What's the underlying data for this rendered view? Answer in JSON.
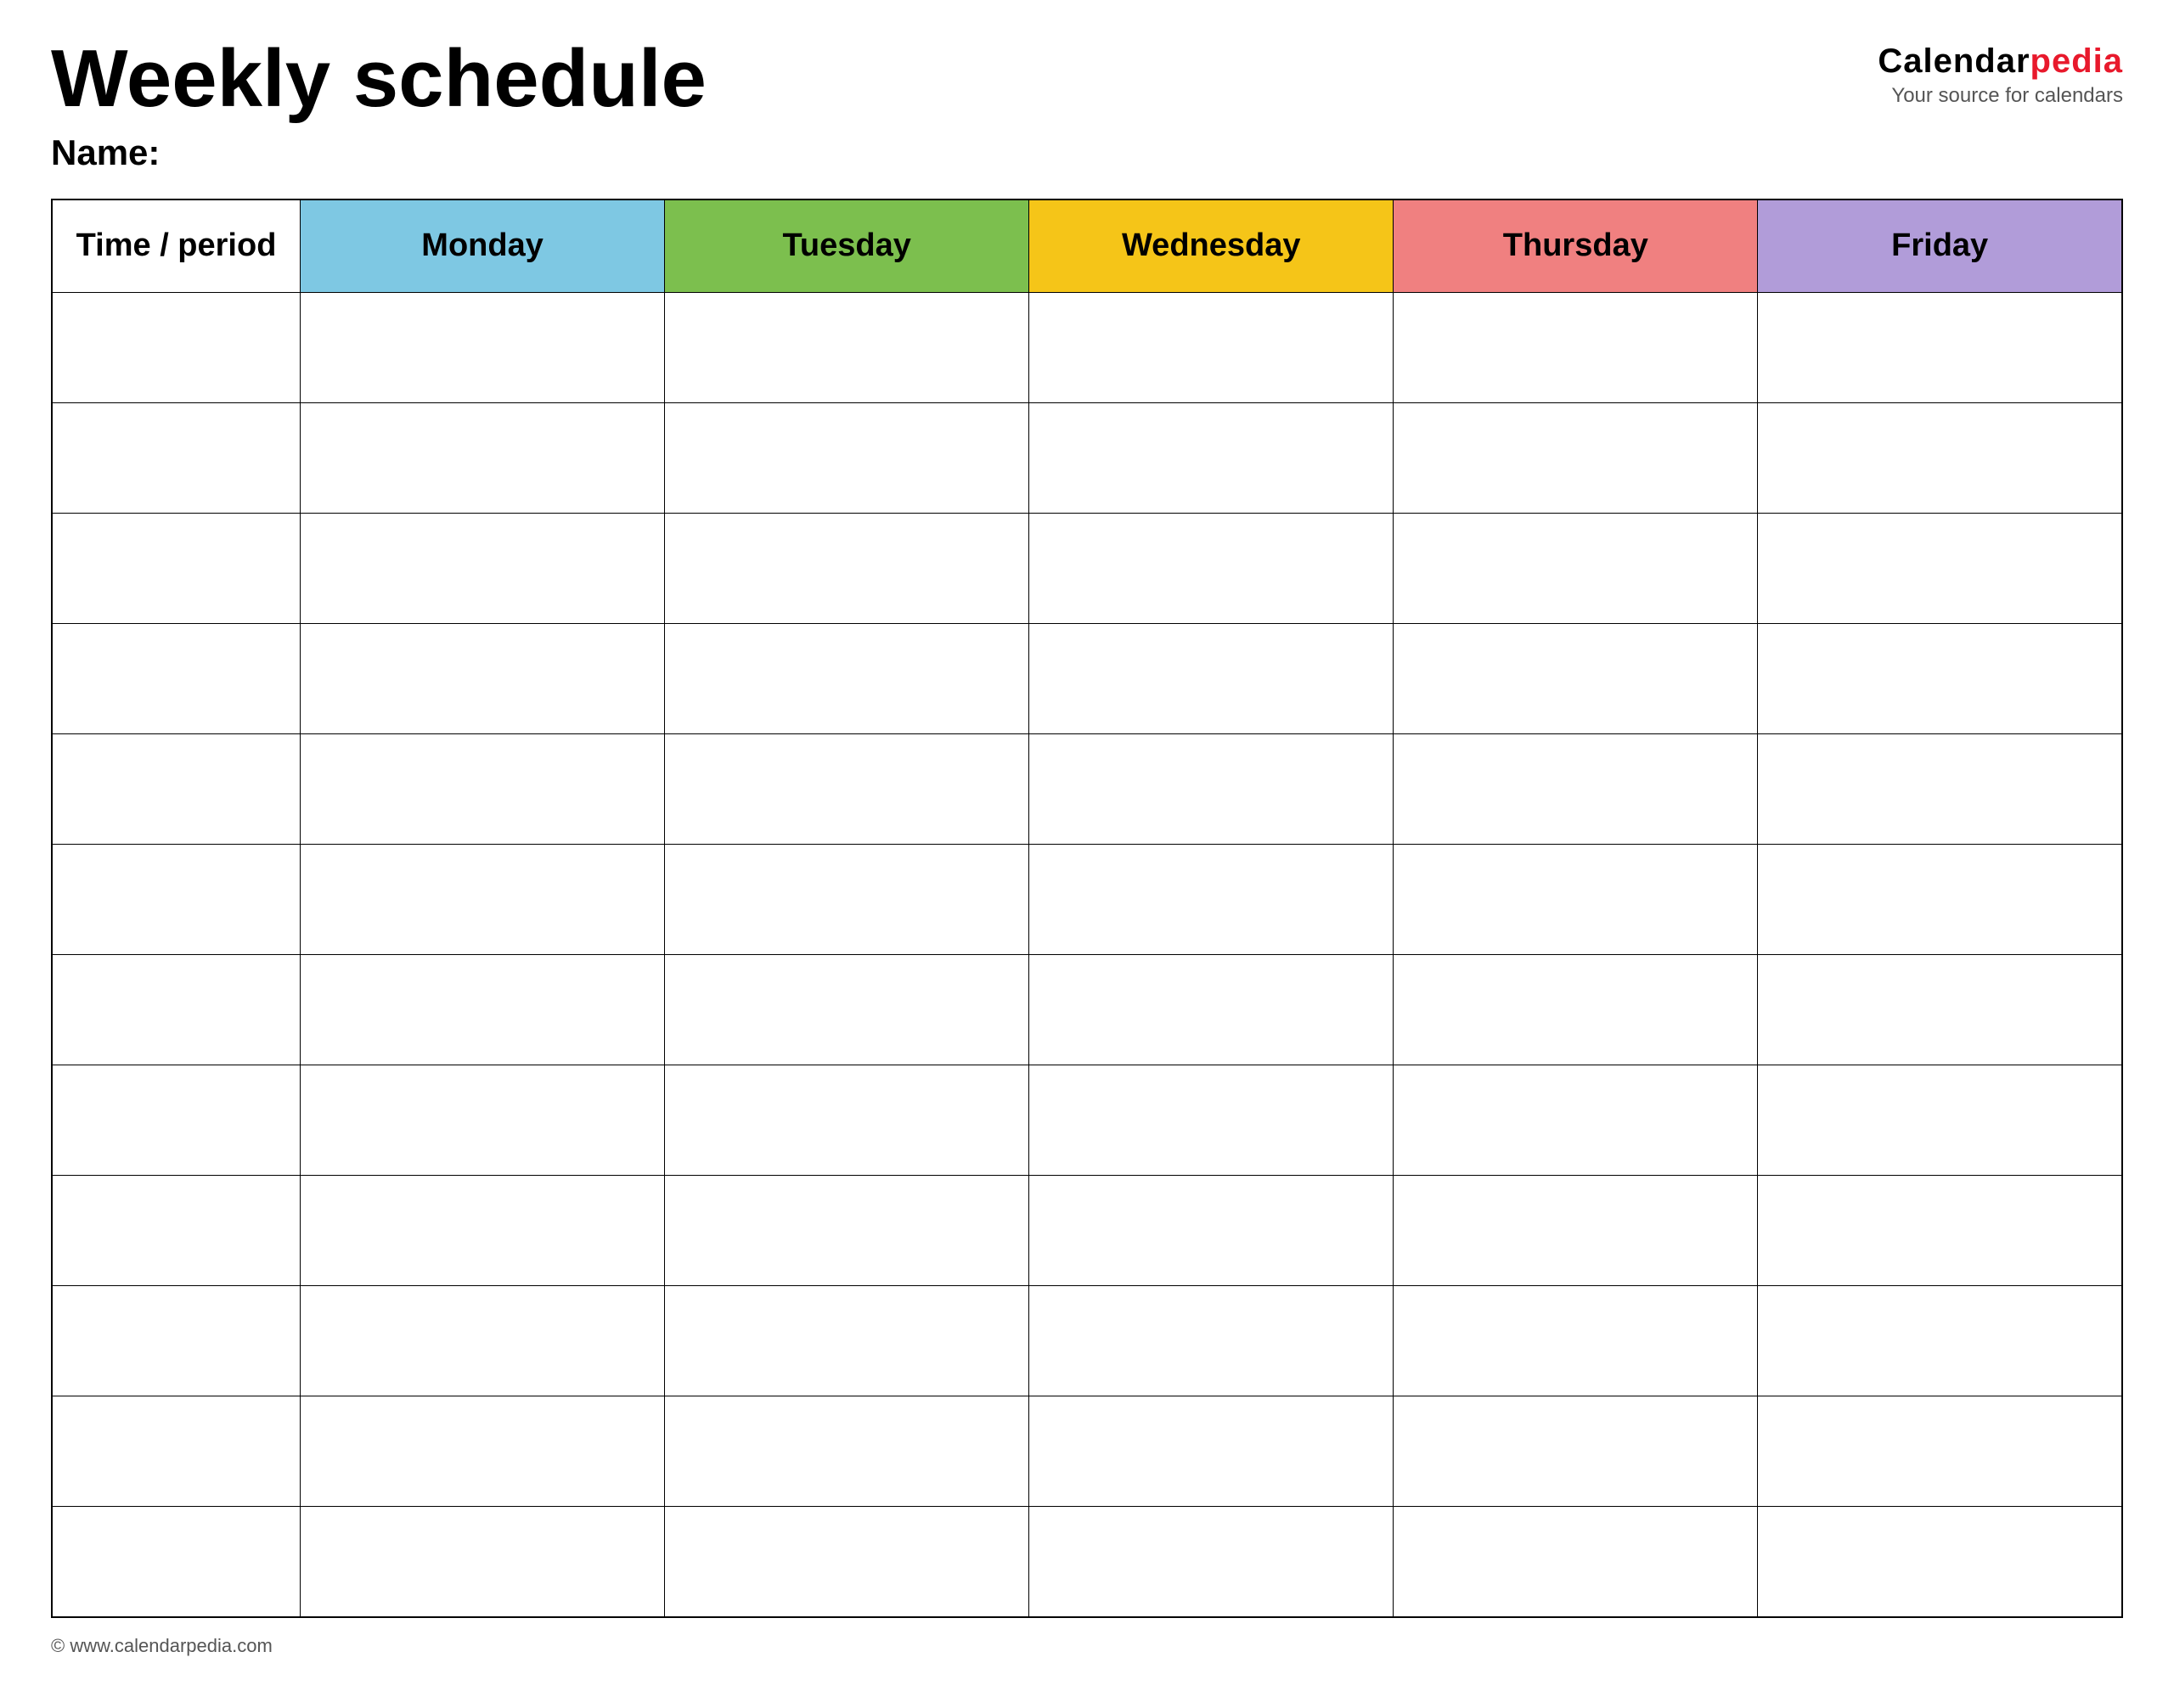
{
  "header": {
    "title": "Weekly schedule",
    "name_label": "Name:",
    "logo": {
      "text_black": "Calendar",
      "text_red": "pedia",
      "tagline": "Your source for calendars"
    }
  },
  "table": {
    "columns": [
      {
        "id": "time",
        "label": "Time / period",
        "color": "#ffffff",
        "text_color": "#000000"
      },
      {
        "id": "monday",
        "label": "Monday",
        "color": "#7ec8e3",
        "text_color": "#000000"
      },
      {
        "id": "tuesday",
        "label": "Tuesday",
        "color": "#7cbf4e",
        "text_color": "#000000"
      },
      {
        "id": "wednesday",
        "label": "Wednesday",
        "color": "#f5c518",
        "text_color": "#000000"
      },
      {
        "id": "thursday",
        "label": "Thursday",
        "color": "#f08080",
        "text_color": "#000000"
      },
      {
        "id": "friday",
        "label": "Friday",
        "color": "#b19cd9",
        "text_color": "#000000"
      }
    ],
    "row_count": 12
  },
  "footer": {
    "url": "© www.calendarpedia.com"
  }
}
